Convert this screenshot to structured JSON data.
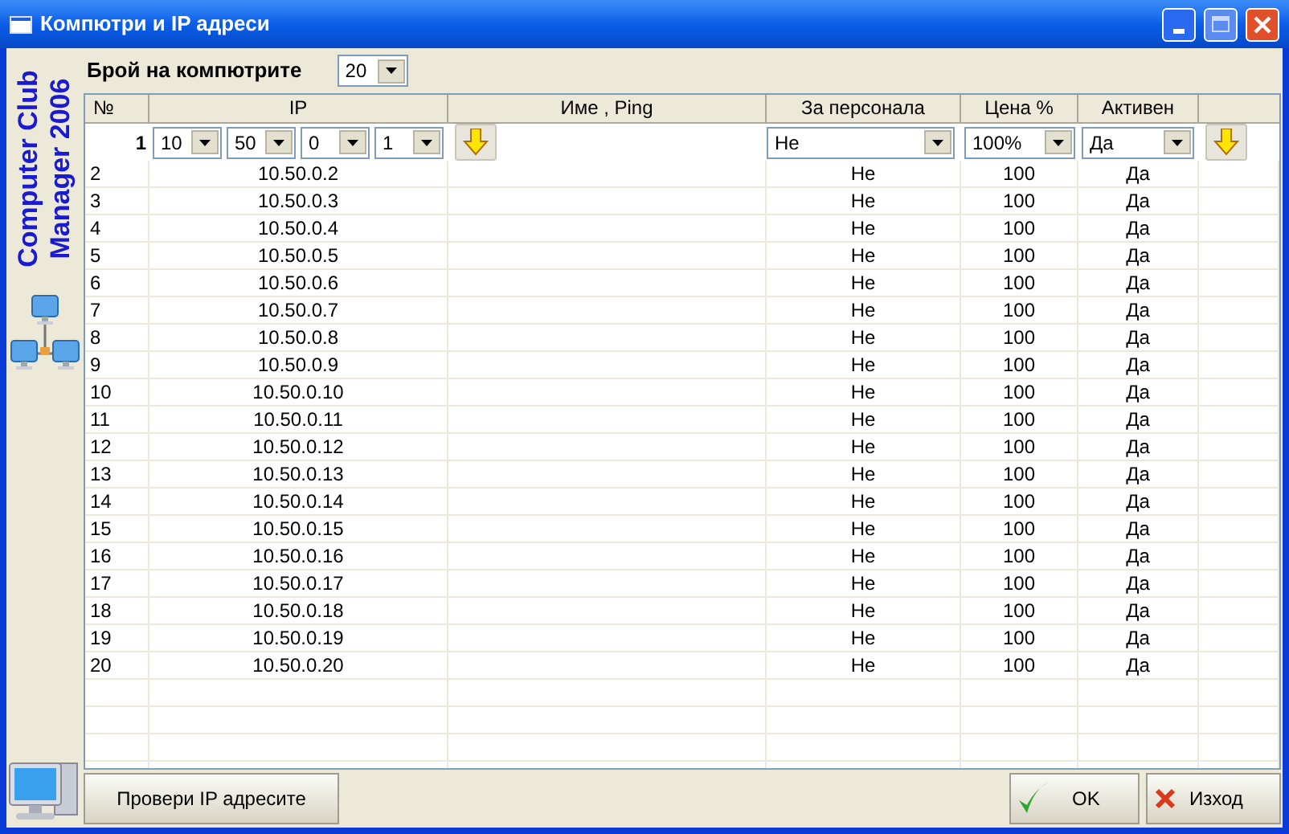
{
  "window": {
    "title": "Компютри и IP адреси"
  },
  "brand": {
    "line_1": "Computer Club",
    "line_2": "Manager 2006"
  },
  "computer_count": {
    "label": "Брой на компютрите",
    "value": "20"
  },
  "table": {
    "columns": [
      "№",
      "IP",
      "Име , Ping",
      "За персонала",
      "Цена %",
      "Активен"
    ],
    "editor": {
      "number": "1",
      "ip_parts": [
        "10",
        "50",
        "0",
        "1"
      ],
      "staff": "Не",
      "price": "100%",
      "active": "Да"
    },
    "rows": [
      {
        "number": "2",
        "ip": "10.50.0.2",
        "staff": "Не",
        "price": "100",
        "active": "Да"
      },
      {
        "number": "3",
        "ip": "10.50.0.3",
        "staff": "Не",
        "price": "100",
        "active": "Да"
      },
      {
        "number": "4",
        "ip": "10.50.0.4",
        "staff": "Не",
        "price": "100",
        "active": "Да"
      },
      {
        "number": "5",
        "ip": "10.50.0.5",
        "staff": "Не",
        "price": "100",
        "active": "Да"
      },
      {
        "number": "6",
        "ip": "10.50.0.6",
        "staff": "Не",
        "price": "100",
        "active": "Да"
      },
      {
        "number": "7",
        "ip": "10.50.0.7",
        "staff": "Не",
        "price": "100",
        "active": "Да"
      },
      {
        "number": "8",
        "ip": "10.50.0.8",
        "staff": "Не",
        "price": "100",
        "active": "Да"
      },
      {
        "number": "9",
        "ip": "10.50.0.9",
        "staff": "Не",
        "price": "100",
        "active": "Да"
      },
      {
        "number": "10",
        "ip": "10.50.0.10",
        "staff": "Не",
        "price": "100",
        "active": "Да"
      },
      {
        "number": "11",
        "ip": "10.50.0.11",
        "staff": "Не",
        "price": "100",
        "active": "Да"
      },
      {
        "number": "12",
        "ip": "10.50.0.12",
        "staff": "Не",
        "price": "100",
        "active": "Да"
      },
      {
        "number": "13",
        "ip": "10.50.0.13",
        "staff": "Не",
        "price": "100",
        "active": "Да"
      },
      {
        "number": "14",
        "ip": "10.50.0.14",
        "staff": "Не",
        "price": "100",
        "active": "Да"
      },
      {
        "number": "15",
        "ip": "10.50.0.15",
        "staff": "Не",
        "price": "100",
        "active": "Да"
      },
      {
        "number": "16",
        "ip": "10.50.0.16",
        "staff": "Не",
        "price": "100",
        "active": "Да"
      },
      {
        "number": "17",
        "ip": "10.50.0.17",
        "staff": "Не",
        "price": "100",
        "active": "Да"
      },
      {
        "number": "18",
        "ip": "10.50.0.18",
        "staff": "Не",
        "price": "100",
        "active": "Да"
      },
      {
        "number": "19",
        "ip": "10.50.0.19",
        "staff": "Не",
        "price": "100",
        "active": "Да"
      },
      {
        "number": "20",
        "ip": "10.50.0.20",
        "staff": "Не",
        "price": "100",
        "active": "Да"
      }
    ]
  },
  "buttons": {
    "check": "Провери IP адресите",
    "ok": "OK",
    "exit": "Изход"
  }
}
